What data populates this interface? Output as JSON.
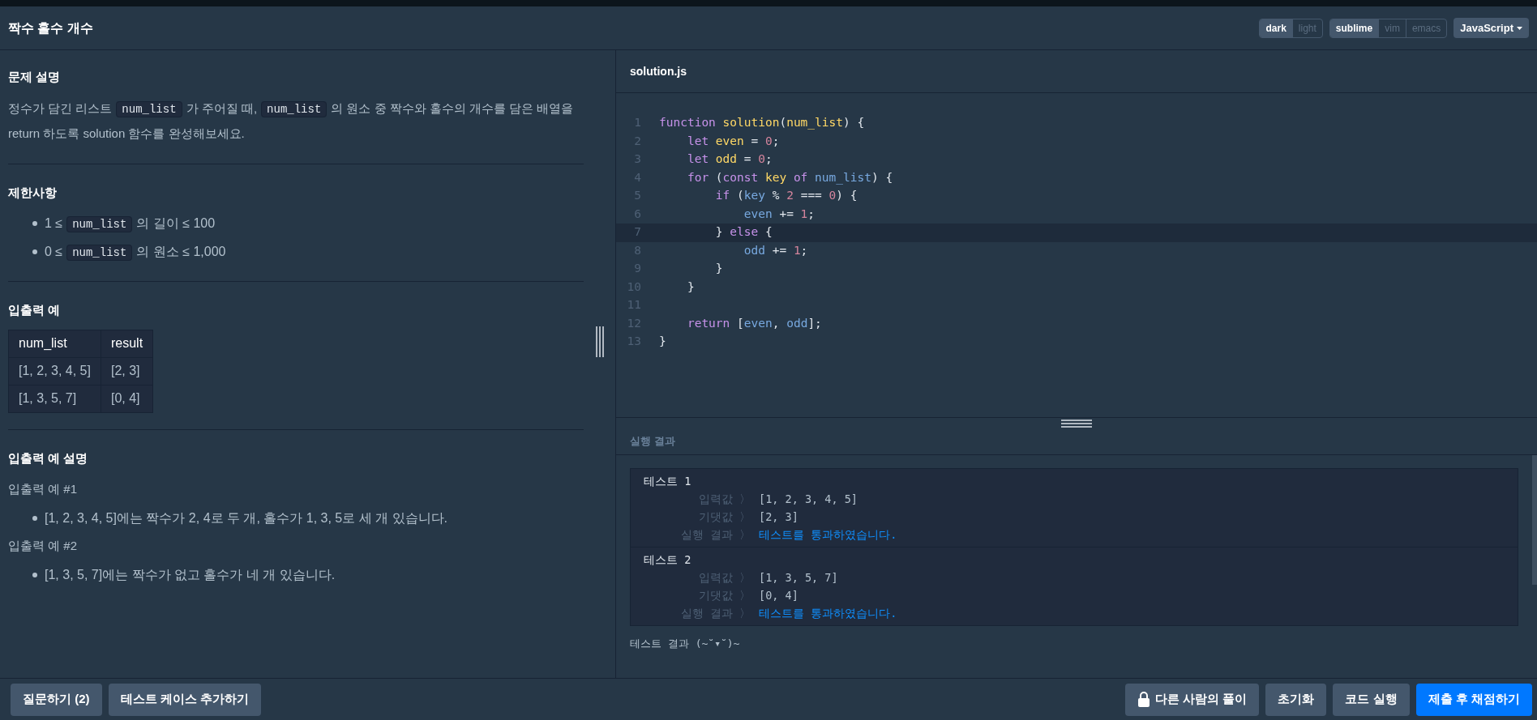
{
  "title": "짝수 홀수 개수",
  "toolbar": {
    "themes": [
      {
        "label": "dark",
        "selected": true
      },
      {
        "label": "light",
        "selected": false
      }
    ],
    "keymaps": [
      {
        "label": "sublime",
        "selected": true
      },
      {
        "label": "vim",
        "selected": false
      },
      {
        "label": "emacs",
        "selected": false
      }
    ],
    "language": "JavaScript"
  },
  "description": {
    "sections": [
      {
        "heading": "문제 설명",
        "blocks": [
          {
            "kind": "paragraph",
            "parts": [
              {
                "kind": "text",
                "text": "정수가 담긴 리스트"
              },
              {
                "kind": "code",
                "text": "num_list"
              },
              {
                "kind": "text",
                "text": "가 주어질 때,"
              },
              {
                "kind": "code",
                "text": "num_list"
              },
              {
                "kind": "text",
                "text": "의 원소 중 짝수와 홀수의 개수를 담은 배열을 return 하도록 solution 함수를 완성해보세요."
              }
            ]
          }
        ]
      },
      {
        "heading": "제한사항",
        "blocks": [
          {
            "kind": "bullet",
            "parts": [
              {
                "kind": "text",
                "text": "1 ≤"
              },
              {
                "kind": "code",
                "text": "num_list"
              },
              {
                "kind": "text",
                "text": "의 길이 ≤ 100"
              }
            ]
          },
          {
            "kind": "bullet",
            "parts": [
              {
                "kind": "text",
                "text": "0 ≤"
              },
              {
                "kind": "code",
                "text": "num_list"
              },
              {
                "kind": "text",
                "text": "의 원소 ≤ 1,000"
              }
            ]
          }
        ]
      },
      {
        "heading": "입출력 예",
        "blocks": [
          {
            "kind": "table",
            "columns": [
              "num_list",
              "result"
            ],
            "rows": [
              [
                "[1, 2, 3, 4, 5]",
                "[2, 3]"
              ],
              [
                "[1, 3, 5, 7]",
                "[0, 4]"
              ]
            ]
          }
        ]
      },
      {
        "heading": "입출력 예 설명",
        "blocks": [
          {
            "kind": "paragraph",
            "parts": [
              {
                "kind": "text",
                "text": "입출력 예 #1"
              }
            ]
          },
          {
            "kind": "bullet",
            "parts": [
              {
                "kind": "text",
                "text": "[1, 2, 3, 4, 5]에는 짝수가 2, 4로 두 개, 홀수가 1, 3, 5로 세 개 있습니다."
              }
            ]
          },
          {
            "kind": "paragraph",
            "parts": [
              {
                "kind": "text",
                "text": "입출력 예 #2"
              }
            ]
          },
          {
            "kind": "bullet",
            "parts": [
              {
                "kind": "text",
                "text": "[1, 3, 5, 7]에는 짝수가 없고 홀수가 네 개 있습니다."
              }
            ]
          }
        ]
      }
    ]
  },
  "editor": {
    "filename": "solution.js",
    "lines": [
      {
        "number": "1",
        "highlighted": false,
        "tokens": [
          {
            "kind": "keyword",
            "text": "function "
          },
          {
            "kind": "name",
            "text": "solution"
          },
          {
            "kind": "plain",
            "text": "("
          },
          {
            "kind": "name",
            "text": "num_list"
          },
          {
            "kind": "plain",
            "text": ") {"
          }
        ]
      },
      {
        "number": "2",
        "highlighted": false,
        "tokens": [
          {
            "kind": "keyword",
            "text": "    let "
          },
          {
            "kind": "name",
            "text": "even"
          },
          {
            "kind": "plain",
            "text": " = "
          },
          {
            "kind": "number",
            "text": "0"
          },
          {
            "kind": "plain",
            "text": ";"
          }
        ]
      },
      {
        "number": "3",
        "highlighted": false,
        "tokens": [
          {
            "kind": "keyword",
            "text": "    let "
          },
          {
            "kind": "name",
            "text": "odd"
          },
          {
            "kind": "plain",
            "text": " = "
          },
          {
            "kind": "number",
            "text": "0"
          },
          {
            "kind": "plain",
            "text": ";"
          }
        ]
      },
      {
        "number": "4",
        "highlighted": false,
        "tokens": [
          {
            "kind": "keyword",
            "text": "    for"
          },
          {
            "kind": "plain",
            "text": " ("
          },
          {
            "kind": "keyword",
            "text": "const "
          },
          {
            "kind": "name",
            "text": "key "
          },
          {
            "kind": "keyword",
            "text": "of "
          },
          {
            "kind": "variable",
            "text": "num_list"
          },
          {
            "kind": "plain",
            "text": ") {"
          }
        ]
      },
      {
        "number": "5",
        "highlighted": false,
        "tokens": [
          {
            "kind": "keyword",
            "text": "        if"
          },
          {
            "kind": "plain",
            "text": " ("
          },
          {
            "kind": "variable",
            "text": "key"
          },
          {
            "kind": "plain",
            "text": " % "
          },
          {
            "kind": "number",
            "text": "2"
          },
          {
            "kind": "plain",
            "text": " === "
          },
          {
            "kind": "number",
            "text": "0"
          },
          {
            "kind": "plain",
            "text": ") {"
          }
        ]
      },
      {
        "number": "6",
        "highlighted": false,
        "tokens": [
          {
            "kind": "variable",
            "text": "            even"
          },
          {
            "kind": "plain",
            "text": " += "
          },
          {
            "kind": "number",
            "text": "1"
          },
          {
            "kind": "plain",
            "text": ";"
          }
        ]
      },
      {
        "number": "7",
        "highlighted": true,
        "tokens": [
          {
            "kind": "plain",
            "text": "        } "
          },
          {
            "kind": "keyword",
            "text": "else"
          },
          {
            "kind": "plain",
            "text": " {"
          }
        ]
      },
      {
        "number": "8",
        "highlighted": false,
        "tokens": [
          {
            "kind": "variable",
            "text": "            odd"
          },
          {
            "kind": "plain",
            "text": " += "
          },
          {
            "kind": "number",
            "text": "1"
          },
          {
            "kind": "plain",
            "text": ";"
          }
        ]
      },
      {
        "number": "9",
        "highlighted": false,
        "tokens": [
          {
            "kind": "plain",
            "text": "        }"
          }
        ]
      },
      {
        "number": "10",
        "highlighted": false,
        "tokens": [
          {
            "kind": "plain",
            "text": "    }"
          }
        ]
      },
      {
        "number": "11",
        "highlighted": false
      },
      {
        "number": "12",
        "highlighted": false,
        "tokens": [
          {
            "kind": "keyword",
            "text": "    return"
          },
          {
            "kind": "plain",
            "text": " ["
          },
          {
            "kind": "variable",
            "text": "even"
          },
          {
            "kind": "plain",
            "text": ", "
          },
          {
            "kind": "variable",
            "text": "odd"
          },
          {
            "kind": "plain",
            "text": "];"
          }
        ]
      },
      {
        "number": "13",
        "highlighted": false,
        "tokens": [
          {
            "kind": "plain",
            "text": "}"
          }
        ]
      }
    ]
  },
  "results": {
    "heading": "실행 결과",
    "tests": [
      {
        "title": "테스트 1",
        "rows": [
          {
            "kind": "input",
            "label": "입력값 〉",
            "value": "[1, 2, 3, 4, 5]"
          },
          {
            "kind": "expected",
            "label": "기댓값 〉",
            "value": "[2, 3]"
          },
          {
            "kind": "result",
            "label": "실행 결과 〉",
            "value": "테스트를 통과하였습니다."
          }
        ]
      },
      {
        "title": "테스트 2",
        "rows": [
          {
            "kind": "input",
            "label": "입력값 〉",
            "value": "[1, 3, 5, 7]"
          },
          {
            "kind": "expected",
            "label": "기댓값 〉",
            "value": "[0, 4]"
          },
          {
            "kind": "result",
            "label": "실행 결과 〉",
            "value": "테스트를 통과하였습니다."
          }
        ]
      }
    ],
    "summary": "테스트 결과 (~˘▾˘)~"
  },
  "footer": {
    "left_buttons": [
      {
        "kind": "secondary",
        "label": "질문하기 (2)"
      },
      {
        "kind": "secondary",
        "label": "테스트 케이스 추가하기"
      }
    ],
    "right_buttons": [
      {
        "kind": "locked",
        "label": "다른 사람의 풀이"
      },
      {
        "kind": "secondary",
        "label": "초기화"
      },
      {
        "kind": "secondary",
        "label": "코드 실행"
      },
      {
        "kind": "primary",
        "label": "제출 후 채점하기"
      }
    ]
  }
}
